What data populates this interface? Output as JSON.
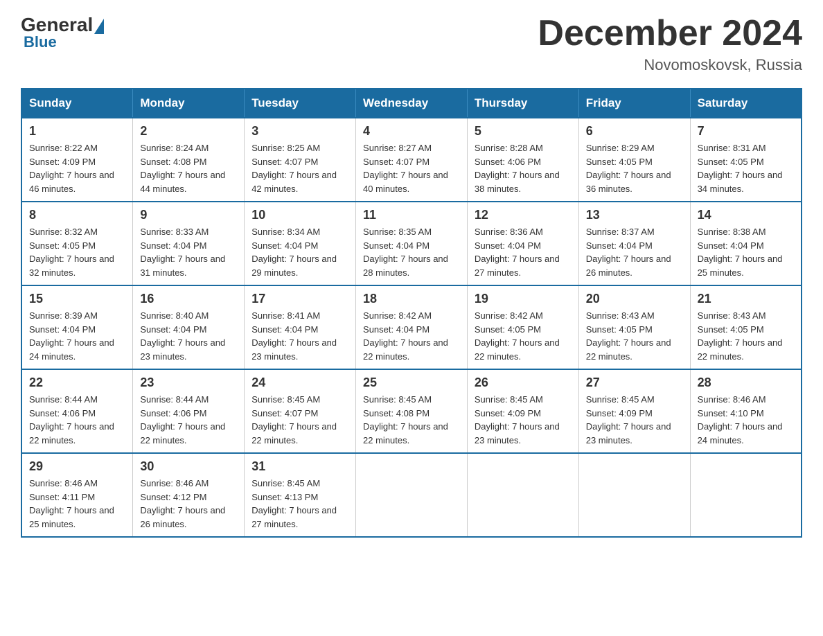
{
  "logo": {
    "general": "General",
    "blue": "Blue"
  },
  "title": "December 2024",
  "subtitle": "Novomoskovsk, Russia",
  "weekdays": [
    "Sunday",
    "Monday",
    "Tuesday",
    "Wednesday",
    "Thursday",
    "Friday",
    "Saturday"
  ],
  "weeks": [
    [
      {
        "day": "1",
        "sunrise": "8:22 AM",
        "sunset": "4:09 PM",
        "daylight": "7 hours and 46 minutes."
      },
      {
        "day": "2",
        "sunrise": "8:24 AM",
        "sunset": "4:08 PM",
        "daylight": "7 hours and 44 minutes."
      },
      {
        "day": "3",
        "sunrise": "8:25 AM",
        "sunset": "4:07 PM",
        "daylight": "7 hours and 42 minutes."
      },
      {
        "day": "4",
        "sunrise": "8:27 AM",
        "sunset": "4:07 PM",
        "daylight": "7 hours and 40 minutes."
      },
      {
        "day": "5",
        "sunrise": "8:28 AM",
        "sunset": "4:06 PM",
        "daylight": "7 hours and 38 minutes."
      },
      {
        "day": "6",
        "sunrise": "8:29 AM",
        "sunset": "4:05 PM",
        "daylight": "7 hours and 36 minutes."
      },
      {
        "day": "7",
        "sunrise": "8:31 AM",
        "sunset": "4:05 PM",
        "daylight": "7 hours and 34 minutes."
      }
    ],
    [
      {
        "day": "8",
        "sunrise": "8:32 AM",
        "sunset": "4:05 PM",
        "daylight": "7 hours and 32 minutes."
      },
      {
        "day": "9",
        "sunrise": "8:33 AM",
        "sunset": "4:04 PM",
        "daylight": "7 hours and 31 minutes."
      },
      {
        "day": "10",
        "sunrise": "8:34 AM",
        "sunset": "4:04 PM",
        "daylight": "7 hours and 29 minutes."
      },
      {
        "day": "11",
        "sunrise": "8:35 AM",
        "sunset": "4:04 PM",
        "daylight": "7 hours and 28 minutes."
      },
      {
        "day": "12",
        "sunrise": "8:36 AM",
        "sunset": "4:04 PM",
        "daylight": "7 hours and 27 minutes."
      },
      {
        "day": "13",
        "sunrise": "8:37 AM",
        "sunset": "4:04 PM",
        "daylight": "7 hours and 26 minutes."
      },
      {
        "day": "14",
        "sunrise": "8:38 AM",
        "sunset": "4:04 PM",
        "daylight": "7 hours and 25 minutes."
      }
    ],
    [
      {
        "day": "15",
        "sunrise": "8:39 AM",
        "sunset": "4:04 PM",
        "daylight": "7 hours and 24 minutes."
      },
      {
        "day": "16",
        "sunrise": "8:40 AM",
        "sunset": "4:04 PM",
        "daylight": "7 hours and 23 minutes."
      },
      {
        "day": "17",
        "sunrise": "8:41 AM",
        "sunset": "4:04 PM",
        "daylight": "7 hours and 23 minutes."
      },
      {
        "day": "18",
        "sunrise": "8:42 AM",
        "sunset": "4:04 PM",
        "daylight": "7 hours and 22 minutes."
      },
      {
        "day": "19",
        "sunrise": "8:42 AM",
        "sunset": "4:05 PM",
        "daylight": "7 hours and 22 minutes."
      },
      {
        "day": "20",
        "sunrise": "8:43 AM",
        "sunset": "4:05 PM",
        "daylight": "7 hours and 22 minutes."
      },
      {
        "day": "21",
        "sunrise": "8:43 AM",
        "sunset": "4:05 PM",
        "daylight": "7 hours and 22 minutes."
      }
    ],
    [
      {
        "day": "22",
        "sunrise": "8:44 AM",
        "sunset": "4:06 PM",
        "daylight": "7 hours and 22 minutes."
      },
      {
        "day": "23",
        "sunrise": "8:44 AM",
        "sunset": "4:06 PM",
        "daylight": "7 hours and 22 minutes."
      },
      {
        "day": "24",
        "sunrise": "8:45 AM",
        "sunset": "4:07 PM",
        "daylight": "7 hours and 22 minutes."
      },
      {
        "day": "25",
        "sunrise": "8:45 AM",
        "sunset": "4:08 PM",
        "daylight": "7 hours and 22 minutes."
      },
      {
        "day": "26",
        "sunrise": "8:45 AM",
        "sunset": "4:09 PM",
        "daylight": "7 hours and 23 minutes."
      },
      {
        "day": "27",
        "sunrise": "8:45 AM",
        "sunset": "4:09 PM",
        "daylight": "7 hours and 23 minutes."
      },
      {
        "day": "28",
        "sunrise": "8:46 AM",
        "sunset": "4:10 PM",
        "daylight": "7 hours and 24 minutes."
      }
    ],
    [
      {
        "day": "29",
        "sunrise": "8:46 AM",
        "sunset": "4:11 PM",
        "daylight": "7 hours and 25 minutes."
      },
      {
        "day": "30",
        "sunrise": "8:46 AM",
        "sunset": "4:12 PM",
        "daylight": "7 hours and 26 minutes."
      },
      {
        "day": "31",
        "sunrise": "8:45 AM",
        "sunset": "4:13 PM",
        "daylight": "7 hours and 27 minutes."
      },
      null,
      null,
      null,
      null
    ]
  ]
}
